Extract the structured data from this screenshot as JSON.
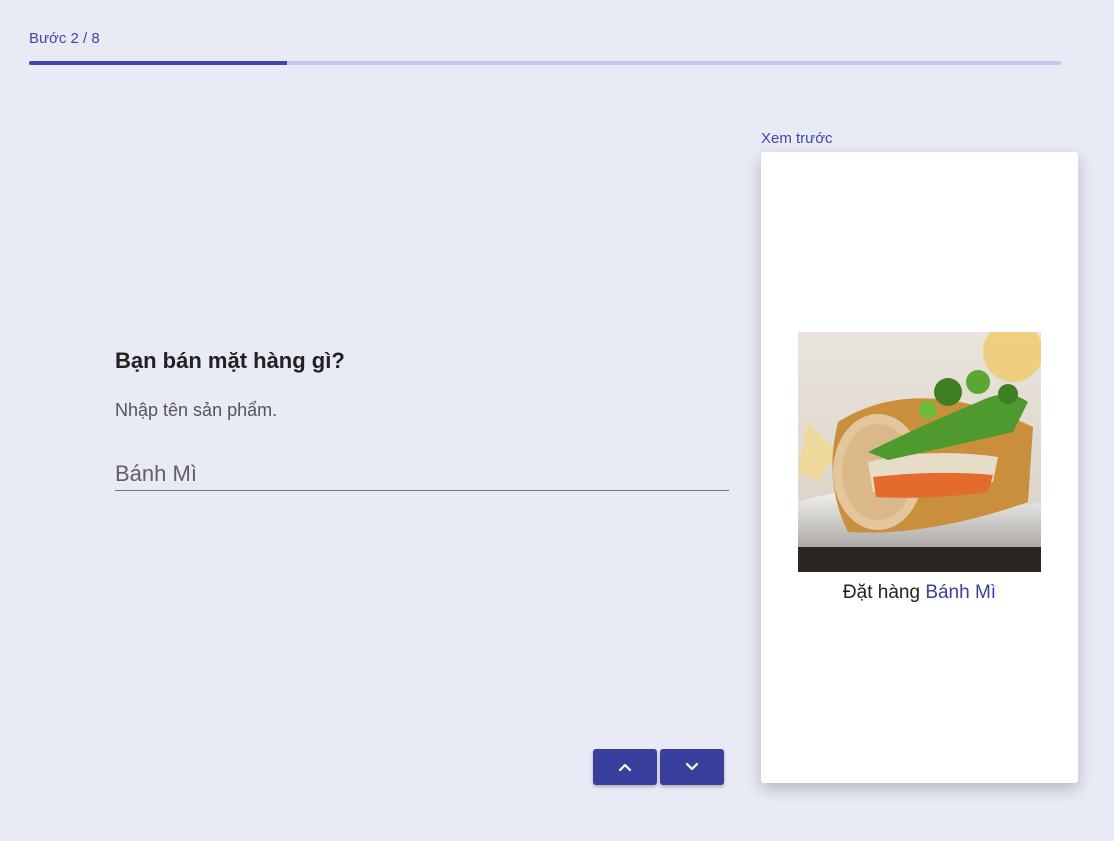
{
  "progress": {
    "step_text": "Bước 2 / 8",
    "current_step": 2,
    "total_steps": 8,
    "fraction": 0.25
  },
  "question": {
    "title": "Bạn bán mặt hàng gì?",
    "hint": "Nhập tên sản phẩm.",
    "input_value": "Bánh Mì"
  },
  "navigation": {
    "up_icon": "chevron-up-icon",
    "down_icon": "chevron-down-icon"
  },
  "preview": {
    "label": "Xem trước",
    "image_subject": "banh-mi-sandwich",
    "caption_prefix": "Đặt hàng",
    "caption_product": "Bánh Mì"
  },
  "colors": {
    "background": "#e8eaf6",
    "accent": "#3f48a8",
    "track": "#c5c8ea",
    "button": "#3a3f9e"
  }
}
